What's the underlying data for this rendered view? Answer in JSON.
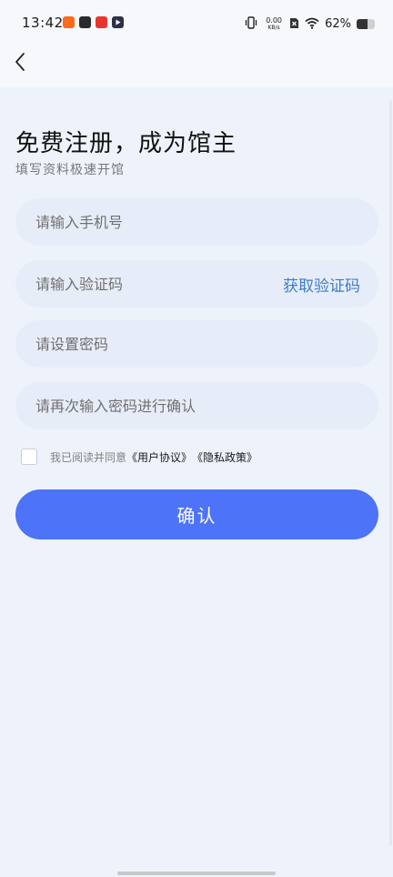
{
  "status_bar": {
    "time": "13:42",
    "app_icons": [
      "app-icon-orange",
      "app-icon-dark",
      "app-icon-red",
      "app-icon-play"
    ],
    "net_speed_value": "0.00",
    "net_speed_unit": "KB/s",
    "battery_percent": "62%",
    "battery_level": 0.62
  },
  "header": {
    "back_icon": "chevron-left-icon"
  },
  "page": {
    "title": "免费注册，成为馆主",
    "subtitle": "填写资料极速开馆"
  },
  "form": {
    "phone_placeholder": "请输入手机号",
    "code_placeholder": "请输入验证码",
    "get_code_label": "获取验证码",
    "password_placeholder": "请设置密码",
    "confirm_password_placeholder": "请再次输入密码进行确认"
  },
  "agreement": {
    "prefix": "我已阅读并同意",
    "user_agreement": "《用户协议》",
    "privacy_policy": "《隐私政策》",
    "checked": false
  },
  "actions": {
    "confirm_label": "确认"
  },
  "colors": {
    "primary": "#4c73f8",
    "link": "#3d7bd0",
    "background": "#eef3fb",
    "field_bg": "#e7edf8"
  }
}
